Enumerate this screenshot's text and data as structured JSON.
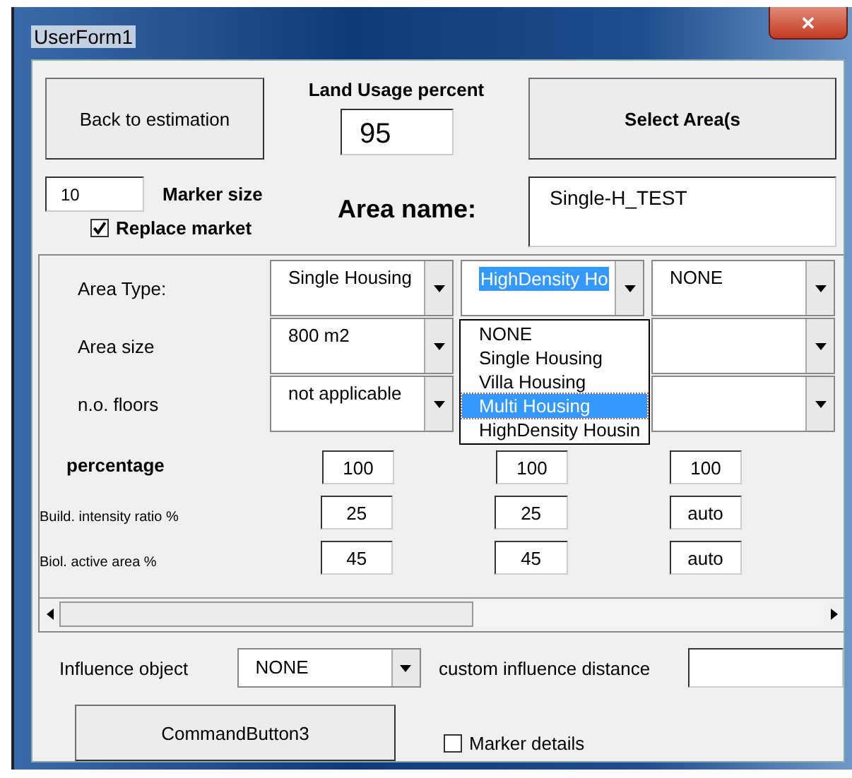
{
  "window": {
    "title": "UserForm1",
    "close": "✕"
  },
  "top": {
    "back_button": "Back to estimation",
    "land_usage_label": "Land Usage percent",
    "land_usage_value": "95",
    "select_button": "Select Area(s",
    "marker_size_value": "10",
    "marker_size_label": "Marker size",
    "replace_market": {
      "label": "Replace market",
      "checked": true
    },
    "area_name_label": "Area name:",
    "area_name_value": "Single-H_TEST"
  },
  "grid": {
    "combo_rows": [
      {
        "label": "Area Type:",
        "cells": [
          {
            "kind": "combo",
            "value": "Single Housing",
            "highlighted": false
          },
          {
            "kind": "combo",
            "value": "HighDensity Ho",
            "highlighted": true
          },
          {
            "kind": "combo",
            "value": "NONE",
            "highlighted": false
          }
        ]
      },
      {
        "label": "Area size",
        "cells": [
          {
            "kind": "combo",
            "value": "800 m2",
            "highlighted": false
          },
          {
            "kind": "covered"
          },
          {
            "kind": "combo",
            "highlighted": false
          }
        ]
      },
      {
        "label": "n.o. floors",
        "cells": [
          {
            "kind": "combo",
            "value": "not applicable",
            "highlighted": false
          },
          {
            "kind": "covered"
          },
          {
            "kind": "combo",
            "highlighted": false
          }
        ]
      }
    ],
    "percentage_label": "percentage",
    "percentage_values": [
      "100",
      "100",
      "100"
    ],
    "ratio_rows": [
      {
        "label": "Build. intensity ratio %",
        "values": [
          "25",
          "25",
          "auto"
        ]
      },
      {
        "label": "Biol. active area %",
        "values": [
          "45",
          "45",
          "auto"
        ]
      }
    ]
  },
  "dropdown": {
    "items": [
      {
        "label": "NONE",
        "selected": false
      },
      {
        "label": "Single Housing",
        "selected": false
      },
      {
        "label": "Villa Housing",
        "selected": false
      },
      {
        "label": "Multi Housing",
        "selected": true
      },
      {
        "label": "HighDensity Housin",
        "selected": false
      }
    ]
  },
  "influence": {
    "label": "Influence object",
    "value": "NONE",
    "distance_label": "custom influence distance"
  },
  "command_button": "CommandButton3",
  "marker_details": {
    "label": "Marker details",
    "checked": false
  }
}
